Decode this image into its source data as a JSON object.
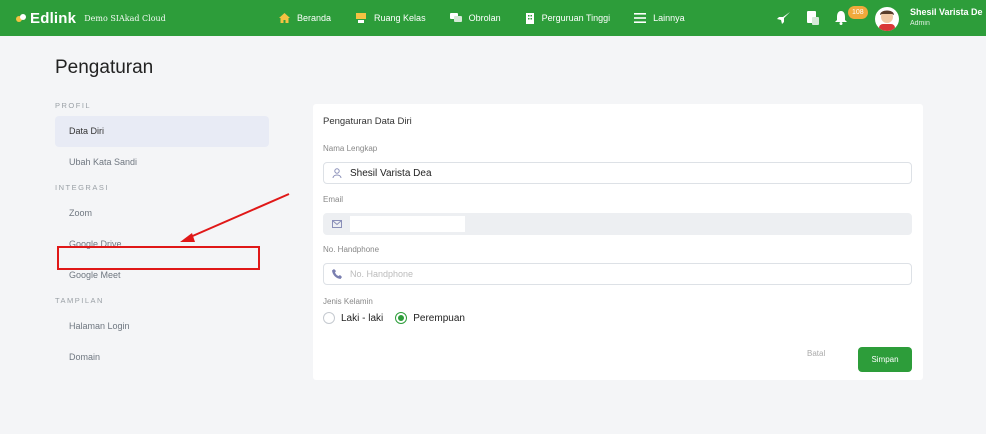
{
  "topbar": {
    "brand_name": "Edlink",
    "brand_sub": "Demo SIAkad Cloud",
    "nav": [
      {
        "label": "Beranda",
        "icon": "home-icon"
      },
      {
        "label": "Ruang Kelas",
        "icon": "classroom-icon"
      },
      {
        "label": "Obrolan",
        "icon": "chat-icon"
      },
      {
        "label": "Perguruan Tinggi",
        "icon": "building-icon"
      },
      {
        "label": "Lainnya",
        "icon": "menu-icon"
      }
    ],
    "notification_count": "108",
    "user_name": "Shesil Varista De",
    "user_role": "Admin",
    "accent_color": "#2d9d3a"
  },
  "page": {
    "title": "Pengaturan"
  },
  "menu": {
    "sections": [
      {
        "title": "PROFIL",
        "items": [
          "Data Diri",
          "Ubah Kata Sandi"
        ]
      },
      {
        "title": "INTEGRASI",
        "items": [
          "Zoom",
          "Google Drive",
          "Google Meet"
        ]
      },
      {
        "title": "TAMPILAN",
        "items": [
          "Halaman Login",
          "Domain"
        ]
      }
    ],
    "active_item": "Data Diri",
    "highlighted_item": "Google Drive"
  },
  "form": {
    "title": "Pengaturan Data Diri",
    "name_label": "Nama Lengkap",
    "name_value": "Shesil Varista Dea",
    "email_label": "Email",
    "phone_label": "No. Handphone",
    "phone_placeholder": "No. Handphone",
    "gender_label": "Jenis Kelamin",
    "gender_options": [
      "Laki - laki",
      "Perempuan"
    ],
    "gender_selected": "Perempuan",
    "cancel_label": "Batal",
    "save_label": "Simpan"
  }
}
